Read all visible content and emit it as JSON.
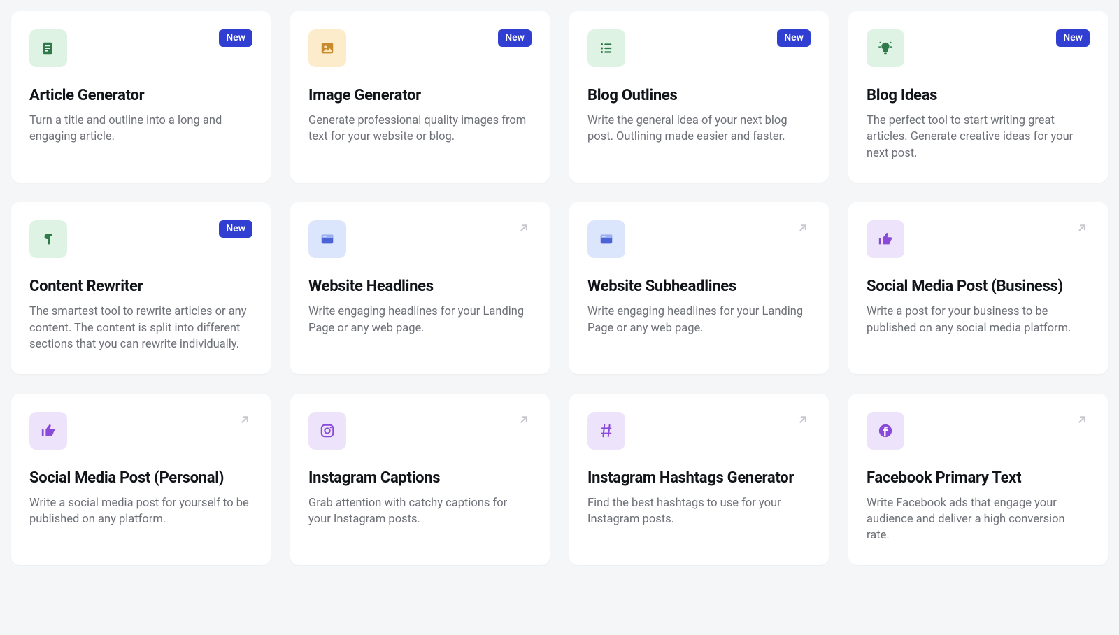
{
  "labels": {
    "new": "New"
  },
  "cards": [
    {
      "title": "Article Generator",
      "desc": "Turn a title and outline into a long and engaging article.",
      "badge": "new",
      "icon": "document-icon",
      "iconColor": "green"
    },
    {
      "title": "Image Generator",
      "desc": "Generate professional quality images from text for your website or blog.",
      "badge": "new",
      "icon": "image-icon",
      "iconColor": "amber"
    },
    {
      "title": "Blog Outlines",
      "desc": "Write the general idea of your next blog post. Outlining made easier and faster.",
      "badge": "new",
      "icon": "list-icon",
      "iconColor": "green"
    },
    {
      "title": "Blog Ideas",
      "desc": "The perfect tool to start writing great articles. Generate creative ideas for your next post.",
      "badge": "new",
      "icon": "lightbulb-icon",
      "iconColor": "green"
    },
    {
      "title": "Content Rewriter",
      "desc": "The smartest tool to rewrite articles or any content. The content is split into different sections that you can rewrite individually.",
      "badge": "new",
      "icon": "paragraph-icon",
      "iconColor": "green"
    },
    {
      "title": "Website Headlines",
      "desc": "Write engaging headlines for your Landing Page or any web page.",
      "badge": "link",
      "icon": "browser-icon",
      "iconColor": "blue"
    },
    {
      "title": "Website Subheadlines",
      "desc": "Write engaging headlines for your Landing Page or any web page.",
      "badge": "link",
      "icon": "browser-icon",
      "iconColor": "blue"
    },
    {
      "title": "Social Media Post (Business)",
      "desc": "Write a post for your business to be published on any social media platform.",
      "badge": "link",
      "icon": "thumbsup-icon",
      "iconColor": "purple"
    },
    {
      "title": "Social Media Post (Personal)",
      "desc": "Write a social media post for yourself to be published on any platform.",
      "badge": "link",
      "icon": "thumbsup-icon",
      "iconColor": "purple"
    },
    {
      "title": "Instagram Captions",
      "desc": "Grab attention with catchy captions for your Instagram posts.",
      "badge": "link",
      "icon": "instagram-icon",
      "iconColor": "purple"
    },
    {
      "title": "Instagram Hashtags Generator",
      "desc": "Find the best hashtags to use for your Instagram posts.",
      "badge": "link",
      "icon": "hashtag-icon",
      "iconColor": "purple"
    },
    {
      "title": "Facebook Primary Text",
      "desc": "Write Facebook ads that engage your audience and deliver a high conversion rate.",
      "badge": "link",
      "icon": "facebook-icon",
      "iconColor": "purple"
    }
  ]
}
